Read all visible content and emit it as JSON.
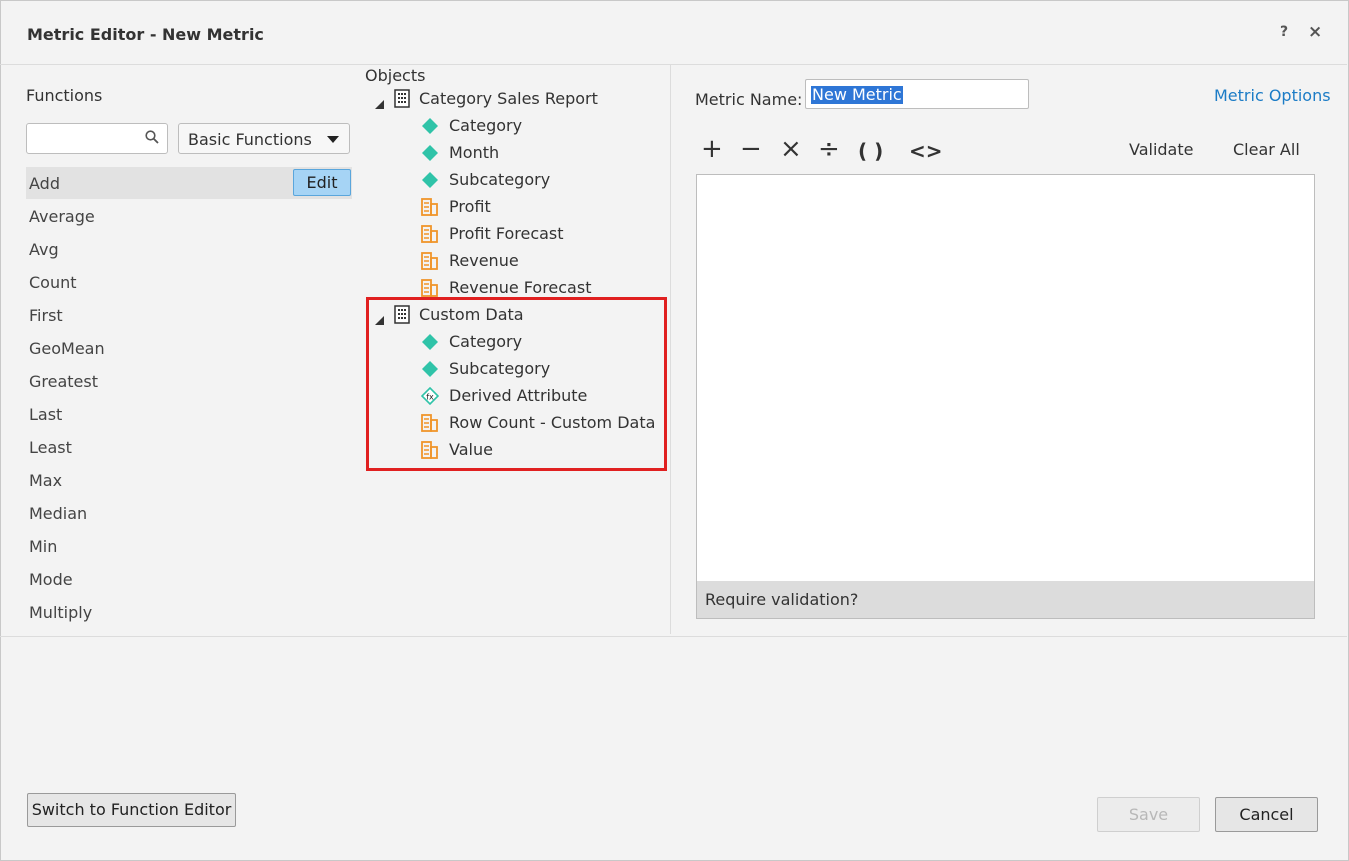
{
  "dialog": {
    "title": "Metric Editor - New Metric",
    "help_glyph": "?",
    "close_glyph": "×"
  },
  "functions": {
    "heading": "Functions",
    "search_placeholder": "",
    "category_select": "Basic Functions",
    "selected": "Add",
    "edit_label": "Edit",
    "items": [
      "Add",
      "Average",
      "Avg",
      "Count",
      "First",
      "GeoMean",
      "Greatest",
      "Last",
      "Least",
      "Max",
      "Median",
      "Min",
      "Mode",
      "Multiply"
    ]
  },
  "objects": {
    "heading": "Objects",
    "groups": [
      {
        "name": "Category Sales Report",
        "expanded": true,
        "children": [
          {
            "label": "Category",
            "icon": "attribute-icon"
          },
          {
            "label": "Month",
            "icon": "attribute-icon"
          },
          {
            "label": "Subcategory",
            "icon": "attribute-icon"
          },
          {
            "label": "Profit",
            "icon": "metric-icon"
          },
          {
            "label": "Profit Forecast",
            "icon": "metric-icon"
          },
          {
            "label": "Revenue",
            "icon": "metric-icon"
          },
          {
            "label": "Revenue Forecast",
            "icon": "metric-icon"
          }
        ]
      },
      {
        "name": "Custom Data",
        "expanded": true,
        "highlighted": true,
        "children": [
          {
            "label": "Category",
            "icon": "attribute-icon"
          },
          {
            "label": "Subcategory",
            "icon": "attribute-icon"
          },
          {
            "label": "Derived Attribute",
            "icon": "derived-attribute-icon"
          },
          {
            "label": "Row Count - Custom Data",
            "icon": "metric-icon"
          },
          {
            "label": "Value",
            "icon": "metric-icon"
          }
        ]
      }
    ]
  },
  "editor": {
    "name_label": "Metric Name:",
    "name_value": "New Metric",
    "options_link": "Metric Options",
    "operators": [
      "+",
      "−",
      "×",
      "÷",
      "( )",
      "<>"
    ],
    "validate_label": "Validate",
    "clear_all_label": "Clear All",
    "status_text": "Require validation?"
  },
  "footer": {
    "switch_label": "Switch to Function Editor",
    "save_label": "Save",
    "save_enabled": false,
    "cancel_label": "Cancel"
  },
  "colors": {
    "attribute": "#2fc3a8",
    "metric": "#f0952a",
    "link": "#1c7cc6",
    "highlight": "#e02020",
    "selection": "#2e76d6"
  }
}
